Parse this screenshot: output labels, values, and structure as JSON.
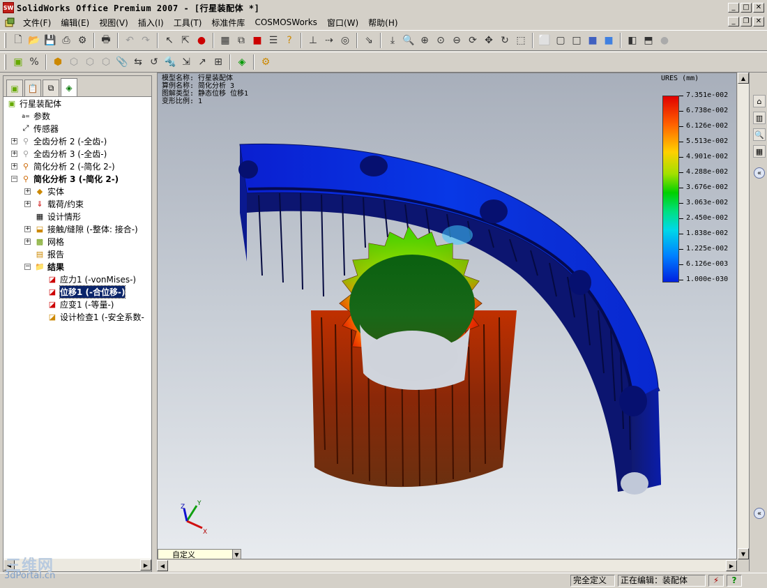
{
  "window": {
    "title": "SolidWorks Office Premium 2007 - [行星装配体 *]",
    "app_icon_text": "SW"
  },
  "menu": {
    "items": [
      "文件(F)",
      "编辑(E)",
      "视图(V)",
      "插入(I)",
      "工具(T)",
      "标准件库",
      "COSMOSWorks",
      "窗口(W)",
      "帮助(H)"
    ]
  },
  "tree": {
    "root": "行星装配体",
    "items": [
      {
        "label": "参数",
        "icon": "equation-icon"
      },
      {
        "label": "传感器",
        "icon": "sensor-icon"
      },
      {
        "label": "全齿分析 2 (-全齿-)",
        "icon": "study-icon"
      },
      {
        "label": "全齿分析 3 (-全齿-)",
        "icon": "study-icon"
      },
      {
        "label": "简化分析  2 (-简化  2-)",
        "icon": "study-icon"
      },
      {
        "label": "简化分析  3 (-简化  2-)",
        "icon": "study-icon"
      },
      {
        "label": "实体",
        "icon": "solid-icon"
      },
      {
        "label": "载荷/约束",
        "icon": "load-icon"
      },
      {
        "label": "设计情形",
        "icon": "scenario-icon"
      },
      {
        "label": "接触/缝隙 (-整体: 接合-)",
        "icon": "contact-icon"
      },
      {
        "label": "网格",
        "icon": "mesh-icon"
      },
      {
        "label": "报告",
        "icon": "report-icon"
      },
      {
        "label": "结果",
        "icon": "results-folder-icon"
      },
      {
        "label": "应力1 (-vonMises-)",
        "icon": "stress-plot-icon"
      },
      {
        "label": "位移1 (-合位移-)",
        "icon": "displacement-plot-icon"
      },
      {
        "label": "应变1 (-等量-)",
        "icon": "strain-plot-icon"
      },
      {
        "label": "设计检查1 (-安全系数-",
        "icon": "design-check-icon"
      }
    ]
  },
  "viewport": {
    "info_lines": [
      "模型名称: 行星装配体",
      "算例名称: 简化分析  3",
      "图解类型: 静态位移 位移1",
      "变形比例: 1"
    ],
    "legend_title": "URES (mm)",
    "legend_values": [
      "7.351e-002",
      "6.738e-002",
      "6.126e-002",
      "5.513e-002",
      "4.901e-002",
      "4.288e-002",
      "3.676e-002",
      "3.063e-002",
      "2.450e-002",
      "1.838e-002",
      "1.225e-002",
      "6.126e-003",
      "1.000e-030"
    ],
    "view_combo": "自定义",
    "axis_labels": {
      "x": "X",
      "y": "Y",
      "z": "Z"
    }
  },
  "status": {
    "definition": "完全定义",
    "editing": "正在编辑：装配体",
    "help": "?"
  },
  "watermark": {
    "line1": "三维网",
    "line2": "3dPortal.cn"
  },
  "colors": {
    "selection": "#0a246a",
    "window_face": "#d4d0c8",
    "gear_blue": "#0a2dd8"
  }
}
